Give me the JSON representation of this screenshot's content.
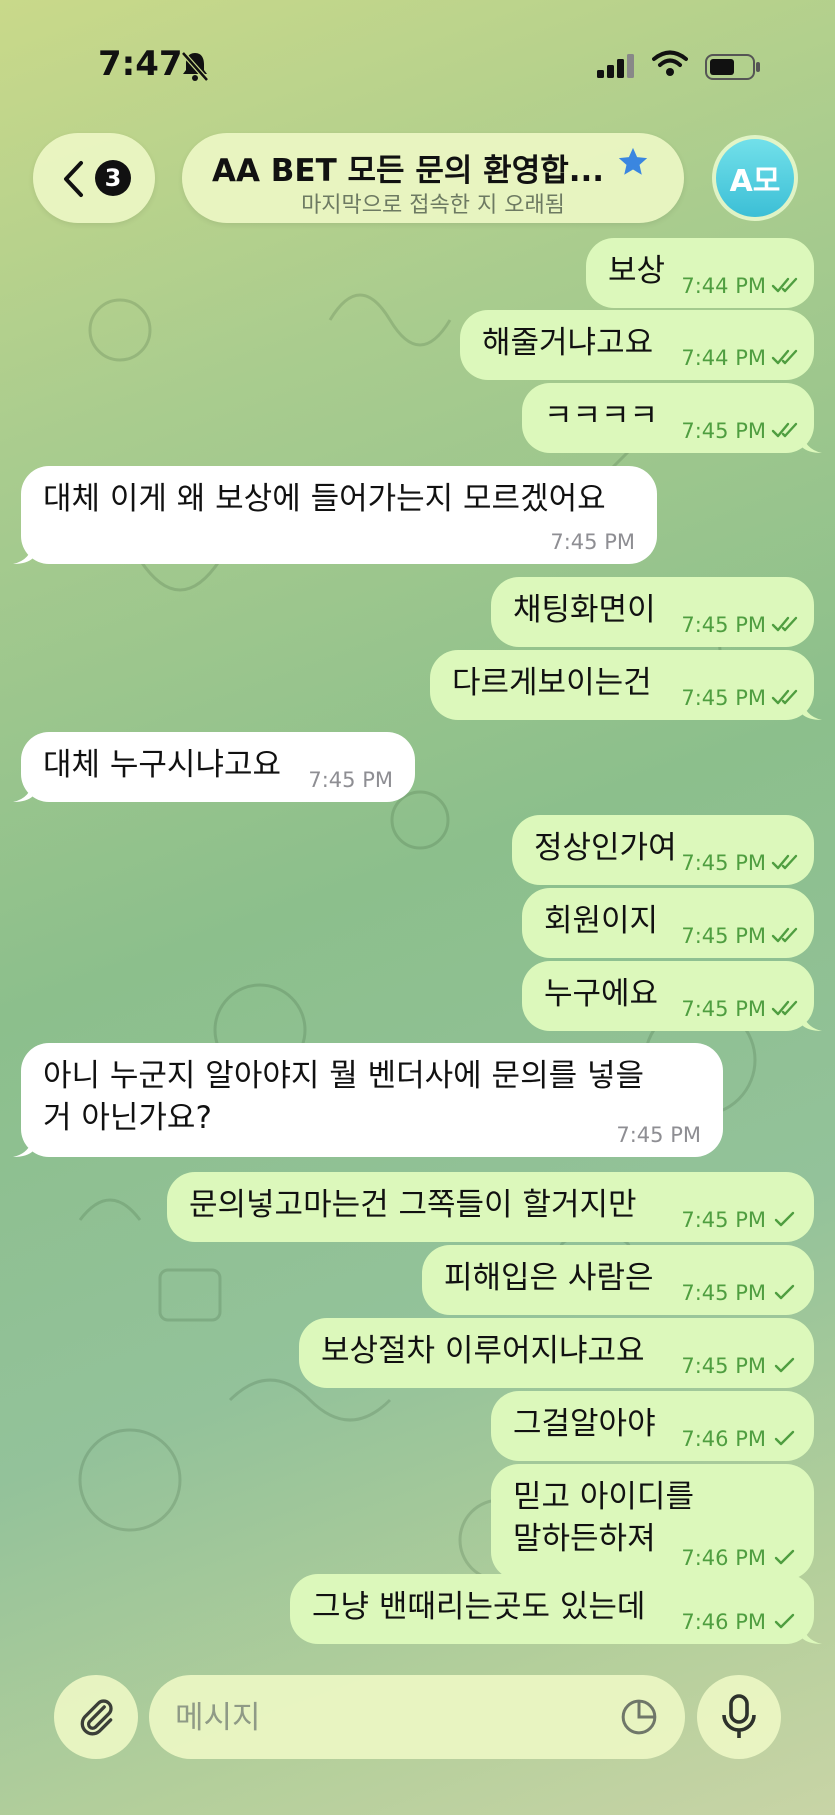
{
  "status_bar": {
    "time": "7:47"
  },
  "header": {
    "back_badge": "3",
    "title": "AA BET 모든 문의 환영합...",
    "subtitle": "마지막으로 접속한 지 오래됨",
    "avatar_initials": "A모"
  },
  "messages": [
    {
      "dir": "out",
      "text": "보상",
      "time": "7:44 PM",
      "read": true
    },
    {
      "dir": "out",
      "text": "해줄거냐고요",
      "time": "7:44 PM",
      "read": true
    },
    {
      "dir": "out",
      "text": "ㅋㅋㅋㅋ",
      "time": "7:45 PM",
      "read": true
    },
    {
      "dir": "in",
      "text": "대체 이게 왜 보상에 들어가는지 모르겠어요",
      "time": "7:45 PM"
    },
    {
      "dir": "out",
      "text": "채팅화면이",
      "time": "7:45 PM",
      "read": true
    },
    {
      "dir": "out",
      "text": "다르게보이는건",
      "time": "7:45 PM",
      "read": true
    },
    {
      "dir": "in",
      "text": "대체 누구시냐고요",
      "time": "7:45 PM"
    },
    {
      "dir": "out",
      "text": "정상인가여",
      "time": "7:45 PM",
      "read": true
    },
    {
      "dir": "out",
      "text": "회원이지",
      "time": "7:45 PM",
      "read": true
    },
    {
      "dir": "out",
      "text": "누구에요",
      "time": "7:45 PM",
      "read": true
    },
    {
      "dir": "in",
      "text": "아니 누군지 알아야지  뭘  벤더사에  문의를 넣을",
      "text2": "거 아닌가요?",
      "time": "7:45 PM"
    },
    {
      "dir": "out",
      "text": "문의넣고마는건 그쪽들이 할거지만",
      "time": "7:45 PM",
      "read": false
    },
    {
      "dir": "out",
      "text": "피해입은 사람은",
      "time": "7:45 PM",
      "read": false
    },
    {
      "dir": "out",
      "text": "보상절차 이루어지냐고요",
      "time": "7:45 PM",
      "read": false
    },
    {
      "dir": "out",
      "text": "그걸알아야",
      "time": "7:46 PM",
      "read": false
    },
    {
      "dir": "out",
      "text": "믿고 아이디를",
      "text2": "말하든하져",
      "time": "7:46 PM",
      "read": false
    },
    {
      "dir": "out",
      "text": "그냥 밴때리는곳도 있는데",
      "time": "7:46 PM",
      "read": false
    }
  ],
  "composer": {
    "placeholder": "메시지"
  },
  "icons": {
    "back": "chevron-left-icon",
    "verified": "star-icon",
    "attach": "paperclip-icon",
    "sticker": "sticker-icon",
    "mic": "microphone-icon"
  },
  "colors": {
    "outgoing_bubble": "#dcf8bb",
    "incoming_bubble": "#ffffff",
    "outgoing_meta": "#4f9e40",
    "accent_star": "#3a86e0"
  }
}
